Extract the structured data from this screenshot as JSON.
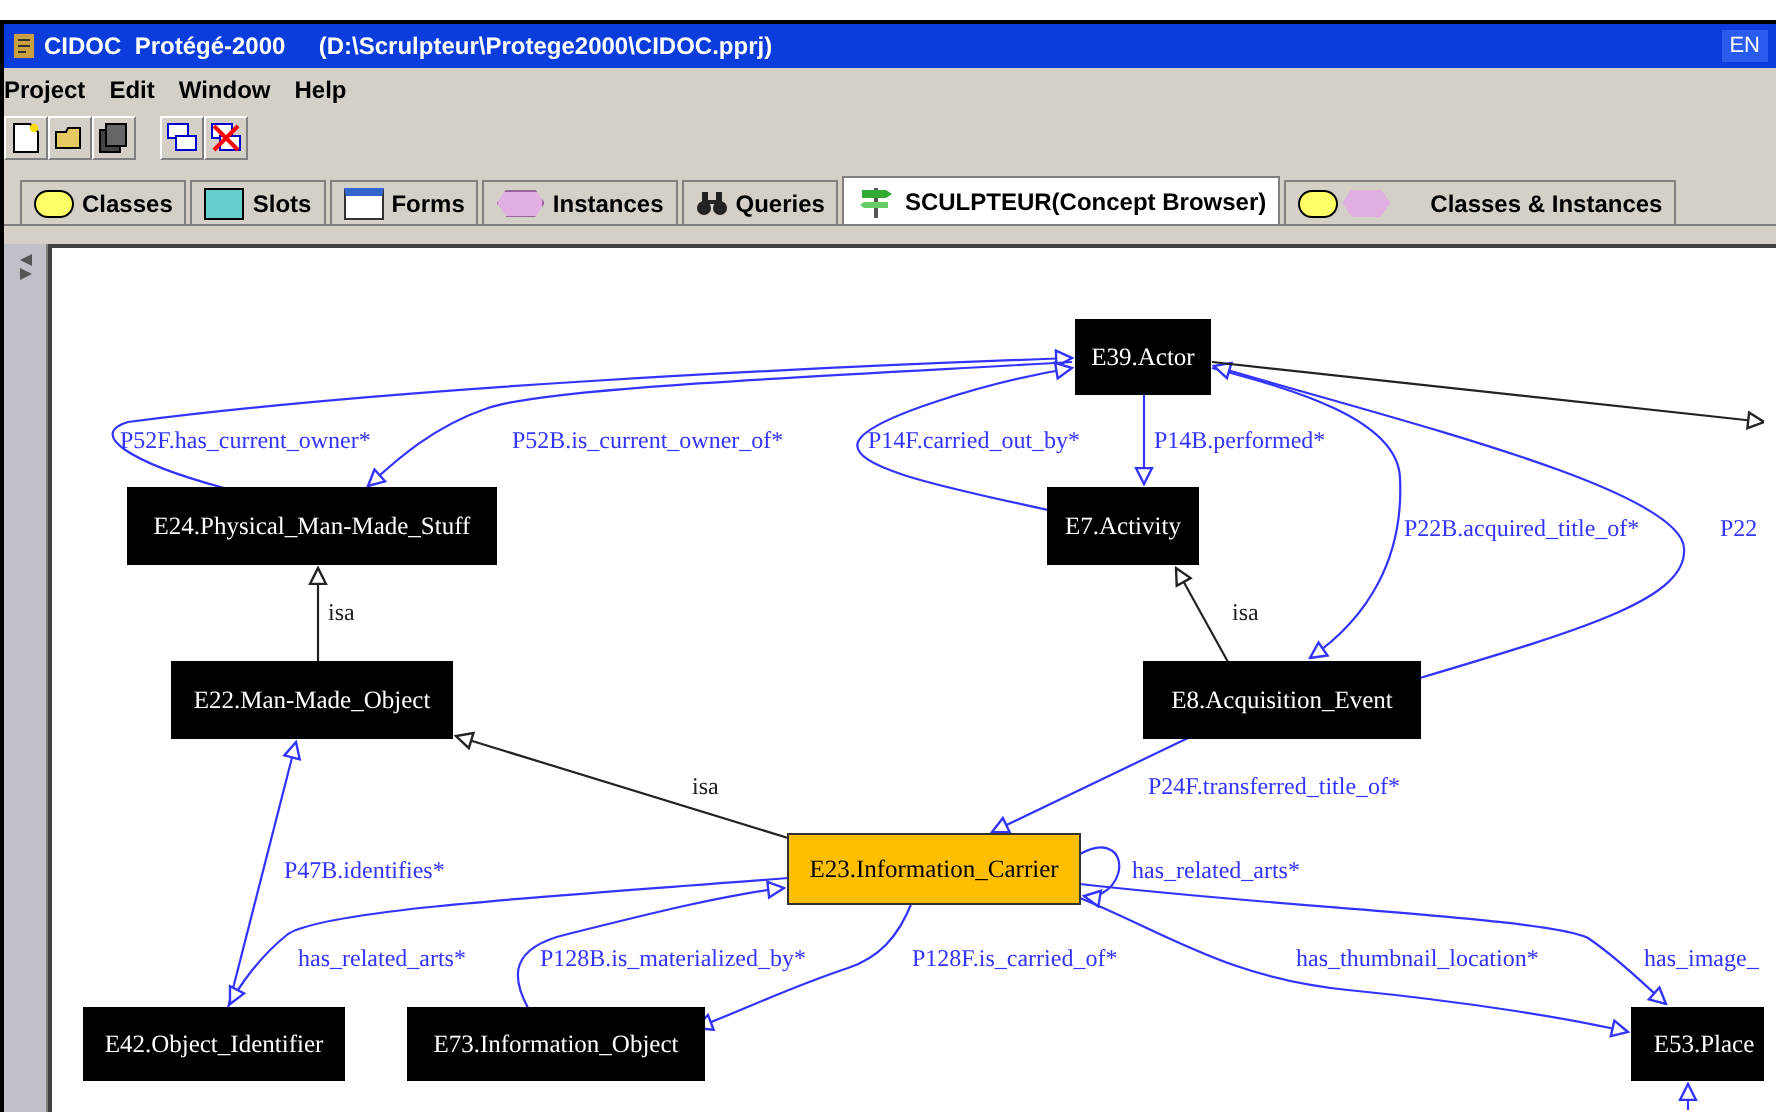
{
  "window": {
    "title": "CIDOC  Protégé-2000     (D:\\Scrulpteur\\Protege2000\\CIDOC.pprj)",
    "language_badge": "EN"
  },
  "menu": [
    "Project",
    "Edit",
    "Window",
    "Help"
  ],
  "tabs": [
    {
      "label": "Classes",
      "kind": "classes",
      "selected": false
    },
    {
      "label": "Slots",
      "kind": "slots",
      "selected": false
    },
    {
      "label": "Forms",
      "kind": "forms",
      "selected": false
    },
    {
      "label": "Instances",
      "kind": "instances",
      "selected": false
    },
    {
      "label": "Queries",
      "kind": "queries",
      "selected": false
    },
    {
      "label": "SCULPTEUR(Concept Browser)",
      "kind": "plugin",
      "selected": true
    },
    {
      "label": "Classes & Instances",
      "kind": "both",
      "selected": false
    }
  ],
  "graph": {
    "nodes": [
      {
        "label": "E39.Actor",
        "selected": false
      },
      {
        "label": "E24.Physical_Man-Made_Stuff",
        "selected": false
      },
      {
        "label": "E7.Activity",
        "selected": false
      },
      {
        "label": "E22.Man-Made_Object",
        "selected": false
      },
      {
        "label": "E8.Acquisition_Event",
        "selected": false
      },
      {
        "label": "E23.Information_Carrier",
        "selected": true
      },
      {
        "label": "E42.Object_Identifier",
        "selected": false
      },
      {
        "label": "E73.Information_Object",
        "selected": false
      },
      {
        "label": "E53.Place",
        "selected": false
      }
    ],
    "edges": [
      {
        "label": "P52F.has_current_owner*",
        "kind": "relation"
      },
      {
        "label": "P52B.is_current_owner_of*",
        "kind": "relation"
      },
      {
        "label": "P14F.carried_out_by*",
        "kind": "relation"
      },
      {
        "label": "P14B.performed*",
        "kind": "relation"
      },
      {
        "label": "isa",
        "kind": "isa"
      },
      {
        "label": "isa",
        "kind": "isa"
      },
      {
        "label": "P22B.acquired_title_of*",
        "kind": "relation"
      },
      {
        "label": "P22",
        "kind": "relation"
      },
      {
        "kind": "isa"
      },
      {
        "label": "isa",
        "kind": "isa"
      },
      {
        "label": "P24F.transferred_title_of*",
        "kind": "relation"
      },
      {
        "label": "has_related_arts*",
        "kind": "relation"
      },
      {
        "label": "P47B.identifies*",
        "kind": "relation"
      },
      {
        "label": "has_related_arts*",
        "kind": "relation"
      },
      {
        "label": "P128B.is_materialized_by*",
        "kind": "relation"
      },
      {
        "label": "P128F.is_carried_of*",
        "kind": "relation"
      },
      {
        "label": "has_thumbnail_location*",
        "kind": "relation"
      },
      {
        "label": "has_image_",
        "kind": "relation"
      },
      {
        "kind": "relation"
      }
    ]
  }
}
